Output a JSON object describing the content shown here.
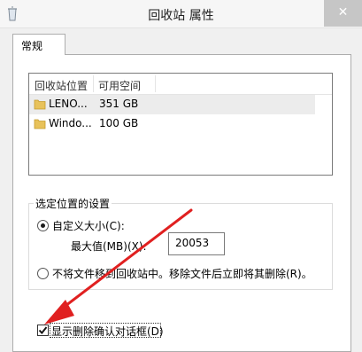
{
  "window": {
    "title": "回收站 属性",
    "close_symbol": "✕"
  },
  "tabs": [
    {
      "label": "常规",
      "active": true
    }
  ],
  "locations": {
    "columns": [
      "回收站位置",
      "可用空间"
    ],
    "rows": [
      {
        "name": "LENO...",
        "free": "351 GB",
        "selected": true
      },
      {
        "name": "Windo...",
        "free": "100 GB",
        "selected": false
      }
    ]
  },
  "settings": {
    "group_title": "选定位置的设置",
    "custom_size": {
      "label": "自定义大小(C):",
      "selected": true
    },
    "max_value": {
      "label": "最大值(MB)(X):",
      "value": "20053"
    },
    "no_move": {
      "label": "不将文件移到回收站中。移除文件后立即将其删除(R)。",
      "selected": false
    }
  },
  "confirm_dialog": {
    "label": "显示删除确认对话框(D)",
    "checked": true
  },
  "colors": {
    "arrow": "#e02020",
    "selected_row": "#ececec",
    "folder": "#e8c25a"
  }
}
